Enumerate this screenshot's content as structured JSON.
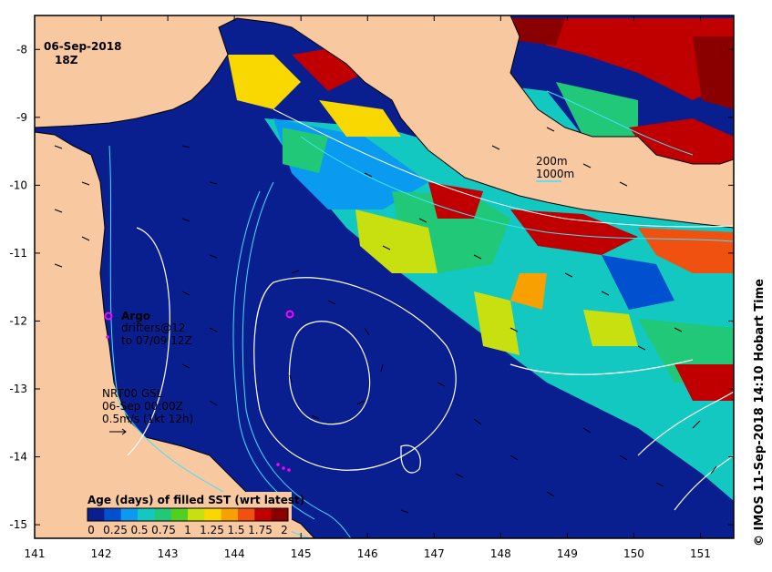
{
  "map": {
    "date": "06-Sep-2018",
    "hour": "18Z",
    "x_ticks": [
      "141",
      "142",
      "143",
      "144",
      "145",
      "146",
      "147",
      "148",
      "149",
      "150",
      "151"
    ],
    "y_ticks": [
      "-8",
      "-9",
      "-10",
      "-11",
      "-12",
      "-13",
      "-14",
      "-15"
    ],
    "lon_range": [
      141,
      151.5
    ],
    "lat_range": [
      -7.5,
      -15.2
    ]
  },
  "contour_legend": {
    "line1": "200m",
    "line2": "1000m"
  },
  "argo": {
    "title": "Argo",
    "drifters_text": "drifters@12",
    "to_text": "to 07/09 12Z"
  },
  "current_info": {
    "line1": "NRT00 GSL",
    "line2": "06-Sep 00:00Z",
    "line3": "0.5m/s (1kt 12h)"
  },
  "colorbar": {
    "title": "Age (days) of filled SST (wrt latest)",
    "ticks": [
      "0",
      "0.25",
      "0.5",
      "0.75",
      "1",
      "1.25",
      "1.5",
      "1.75",
      "2"
    ],
    "colors": [
      "#0a1f8f",
      "#0050d0",
      "#0a9af0",
      "#12c8c0",
      "#20c878",
      "#50d020",
      "#c8e010",
      "#f8d800",
      "#f8a000",
      "#f05010",
      "#c00000",
      "#8a0000"
    ]
  },
  "side_caption": "© IMOS 11-Sep-2018 14:10 Hobart Time"
}
